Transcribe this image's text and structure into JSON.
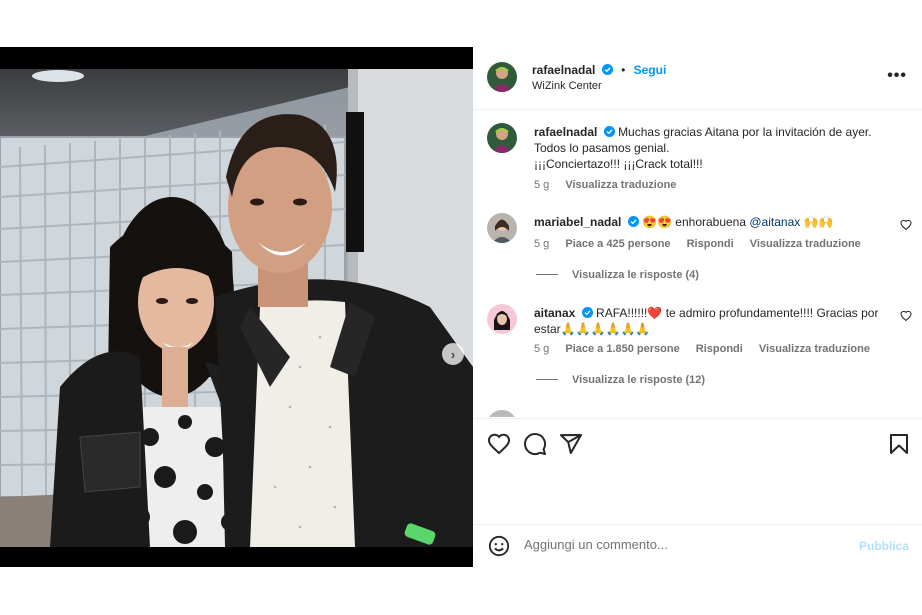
{
  "post": {
    "author": "rafaelnadal",
    "follow_label": "Segui",
    "separator": "•",
    "location": "WiZink Center",
    "more_label": "•••"
  },
  "caption": {
    "author": "rafaelnadal",
    "line1": "Muchas gracias Aitana por la invitación de ayer.",
    "line2": "Todos lo pasamos genial.",
    "line3": "¡¡¡Conciertazo!!! ¡¡¡Crack total!!!",
    "time": "5 g",
    "translate_label": "Visualizza traduzione"
  },
  "comments": [
    {
      "author": "mariabel_nadal",
      "emoji_lead": "😍😍",
      "text": "enhorabuena",
      "mention": "@aitanax",
      "emoji_trail": "🙌🙌",
      "time": "5 g",
      "likes": "Piace a 425 persone",
      "reply_label": "Rispondi",
      "translate_label": "Visualizza traduzione",
      "replies_label": "Visualizza le risposte (4)"
    },
    {
      "author": "aitanax",
      "text_lead": "RAFA!!!!!!",
      "heart_emoji": "❤️",
      "text": "te admiro profundamente!!!! Gracias por estar",
      "emoji_trail": "🙏🙏🙏🙏🙏🙏",
      "time": "5 g",
      "likes": "Piace a 1.850 persone",
      "reply_label": "Rispondi",
      "translate_label": "Visualizza traduzione",
      "replies_label": "Visualizza le risposte (12)"
    }
  ],
  "icons": {
    "like": "heart-icon",
    "comment": "comment-icon",
    "share": "share-icon",
    "save": "bookmark-icon",
    "emoji": "emoji-icon",
    "next": "chevron-right-icon",
    "verified": "verified-badge-icon"
  },
  "add_comment": {
    "placeholder": "Aggiungi un commento...",
    "publish_label": "Pubblica"
  },
  "colors": {
    "accent": "#0095f6",
    "verified": "#0095f6",
    "publish_disabled": "#b2dffc",
    "muted": "#737373"
  }
}
